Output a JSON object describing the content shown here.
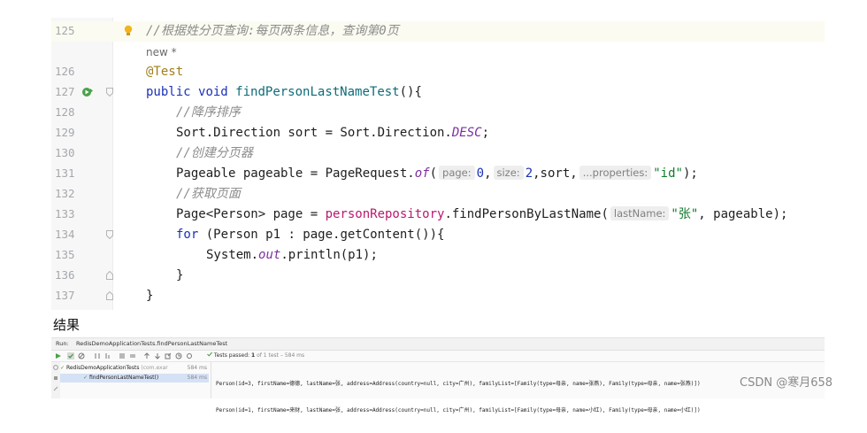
{
  "editor": {
    "lines": [
      {
        "no": "125",
        "comment": "//根据姓分页查询:每页两条信息，查询第0页"
      },
      {
        "new_label": "new *"
      },
      {
        "no": "126",
        "annotation": "@Test"
      },
      {
        "no": "127",
        "kw_public": "public",
        "kw_void": "void",
        "method": "findPersonLastNameTest",
        "rest": "(){"
      },
      {
        "no": "128",
        "comment": "//降序排序"
      },
      {
        "no": "129",
        "pre": "Sort.Direction sort = Sort.Direction.",
        "enum": "DESC",
        "post": ";"
      },
      {
        "no": "130",
        "comment": "//创建分页器"
      },
      {
        "no": "131",
        "pre": "Pageable pageable = PageRequest.",
        "static_method": "of",
        "paren": "(",
        "hint_page": "page:",
        "page_val": "0",
        "comma1": ",",
        "hint_size": "size:",
        "size_val": "2",
        "mid": ",sort,",
        "hint_props": "...properties:",
        "str": "\"id\"",
        "end": ");"
      },
      {
        "no": "132",
        "comment": "//获取页面"
      },
      {
        "no": "133",
        "pre": "Page<Person> page = ",
        "repo": "personRepository",
        "call": ".findPersonByLastName(",
        "hint_last": "lastName:",
        "str": "\"张\"",
        "end": ", pageable);"
      },
      {
        "no": "134",
        "kw_for": "for",
        "rest": " (Person p1 : page.getContent()){"
      },
      {
        "no": "135",
        "pre": "System.",
        "field": "out",
        "post": ".println(p1);"
      },
      {
        "no": "136",
        "text": "}"
      },
      {
        "no": "137",
        "text": "}"
      }
    ]
  },
  "result_label": "结果",
  "run_panel": {
    "run_label": "Run:",
    "tab": "RedisDemoApplicationTests.findPersonLastNameTest",
    "tests_passed_prefix": "Tests passed:",
    "tests_passed_count": "1",
    "tests_passed_suffix": "of 1 test – 584 ms",
    "tree_suite": "RedisDemoApplicationTests",
    "tree_suite_pkg": "(com.exar",
    "tree_suite_time": "584 ms",
    "tree_test": "findPersonLastNameTest()",
    "tree_test_time": "584 ms",
    "console_line1": "Person(id=3, firstName=德德, lastName=张, address=Address(country=null, city=广州), familyList=[Family(type=母亲, name=张燕), Family(type=母亲, name=张燕)])",
    "console_line2": "Person(id=1, firstName=来财, lastName=张, address=Address(country=null, city=广州), familyList=[Family(type=母亲, name=小红), Family(type=母亲, name=小红)])"
  },
  "watermark": "CSDN @寒月658",
  "colors": {
    "keyword": "#1a31b8",
    "comment": "#8c8c8c",
    "string": "#117a2b",
    "annotation": "#a07f1a",
    "passed": "#3c9b3c"
  }
}
